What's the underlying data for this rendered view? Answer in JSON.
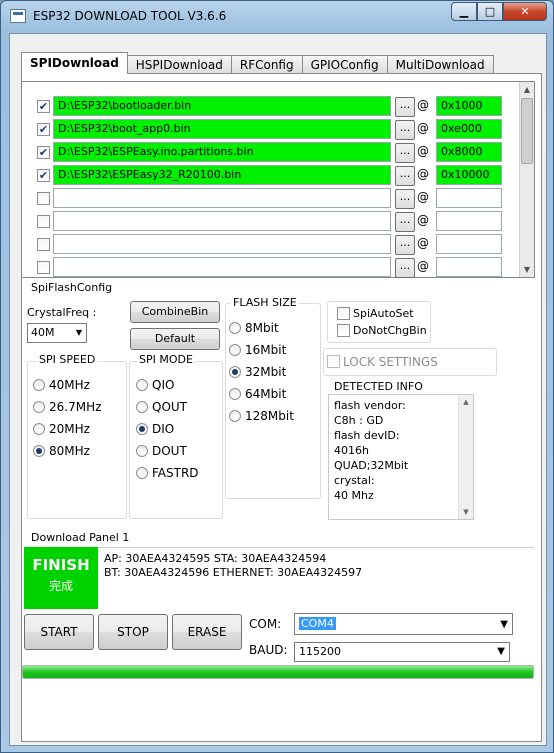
{
  "window": {
    "title": "ESP32 DOWNLOAD TOOL V3.6.6"
  },
  "tabs": [
    {
      "label": "SPIDownload",
      "active": true
    },
    {
      "label": "HSPIDownload",
      "active": false
    },
    {
      "label": "RFConfig",
      "active": false
    },
    {
      "label": "GPIOConfig",
      "active": false
    },
    {
      "label": "MultiDownload",
      "active": false
    }
  ],
  "files": [
    {
      "checked": true,
      "path": "D:\\ESP32\\bootloader.bin",
      "addr": "0x1000"
    },
    {
      "checked": true,
      "path": "D:\\ESP32\\boot_app0.bin",
      "addr": "0xe000"
    },
    {
      "checked": true,
      "path": "D:\\ESP32\\ESPEasy.ino.partitions.bin",
      "addr": "0x8000"
    },
    {
      "checked": true,
      "path": "D:\\ESP32\\ESPEasy32_R20100.bin",
      "addr": "0x10000"
    },
    {
      "checked": false,
      "path": "",
      "addr": ""
    },
    {
      "checked": false,
      "path": "",
      "addr": ""
    },
    {
      "checked": false,
      "path": "",
      "addr": ""
    },
    {
      "checked": false,
      "path": "",
      "addr": ""
    }
  ],
  "browse_label": "...",
  "at_label": "@",
  "spi_flash_config": {
    "title": "SpiFlashConfig",
    "crystal_label": "CrystalFreq :",
    "crystal_value": "40M",
    "combine_label": "CombineBin",
    "default_label": "Default",
    "spi_speed": {
      "title": "SPI SPEED",
      "options": [
        "40MHz",
        "26.7MHz",
        "20MHz",
        "80MHz"
      ],
      "selected": "80MHz"
    },
    "spi_mode": {
      "title": "SPI MODE",
      "options": [
        "QIO",
        "QOUT",
        "DIO",
        "DOUT",
        "FASTRD"
      ],
      "selected": "DIO"
    },
    "flash_size": {
      "title": "FLASH SIZE",
      "options": [
        "8Mbit",
        "16Mbit",
        "32Mbit",
        "64Mbit",
        "128Mbit"
      ],
      "selected": "32Mbit"
    },
    "spi_auto_set": {
      "label": "SpiAutoSet",
      "checked": false
    },
    "do_not_chg_bin": {
      "label": "DoNotChgBin",
      "checked": false
    },
    "lock_settings": {
      "label": "LOCK SETTINGS",
      "checked": false
    },
    "detected_info": {
      "title": "DETECTED INFO",
      "lines": [
        "flash vendor:",
        "C8h : GD",
        "flash devID:",
        "4016h",
        "QUAD;32Mbit",
        "crystal:",
        "40 Mhz"
      ]
    }
  },
  "download_panel": {
    "title": "Download Panel 1",
    "status": "FINISH",
    "status_sub": "完成",
    "status_color": "#00d200",
    "mac_line1": "AP:  30AEA4324595  STA:  30AEA4324594",
    "mac_line2": "BT:  30AEA4324596  ETHERNET:  30AEA4324597",
    "start_label": "START",
    "stop_label": "STOP",
    "erase_label": "ERASE",
    "com_label": "COM:",
    "com_value": "COM4",
    "baud_label": "BAUD:",
    "baud_value": "115200",
    "progress": 1.0
  }
}
